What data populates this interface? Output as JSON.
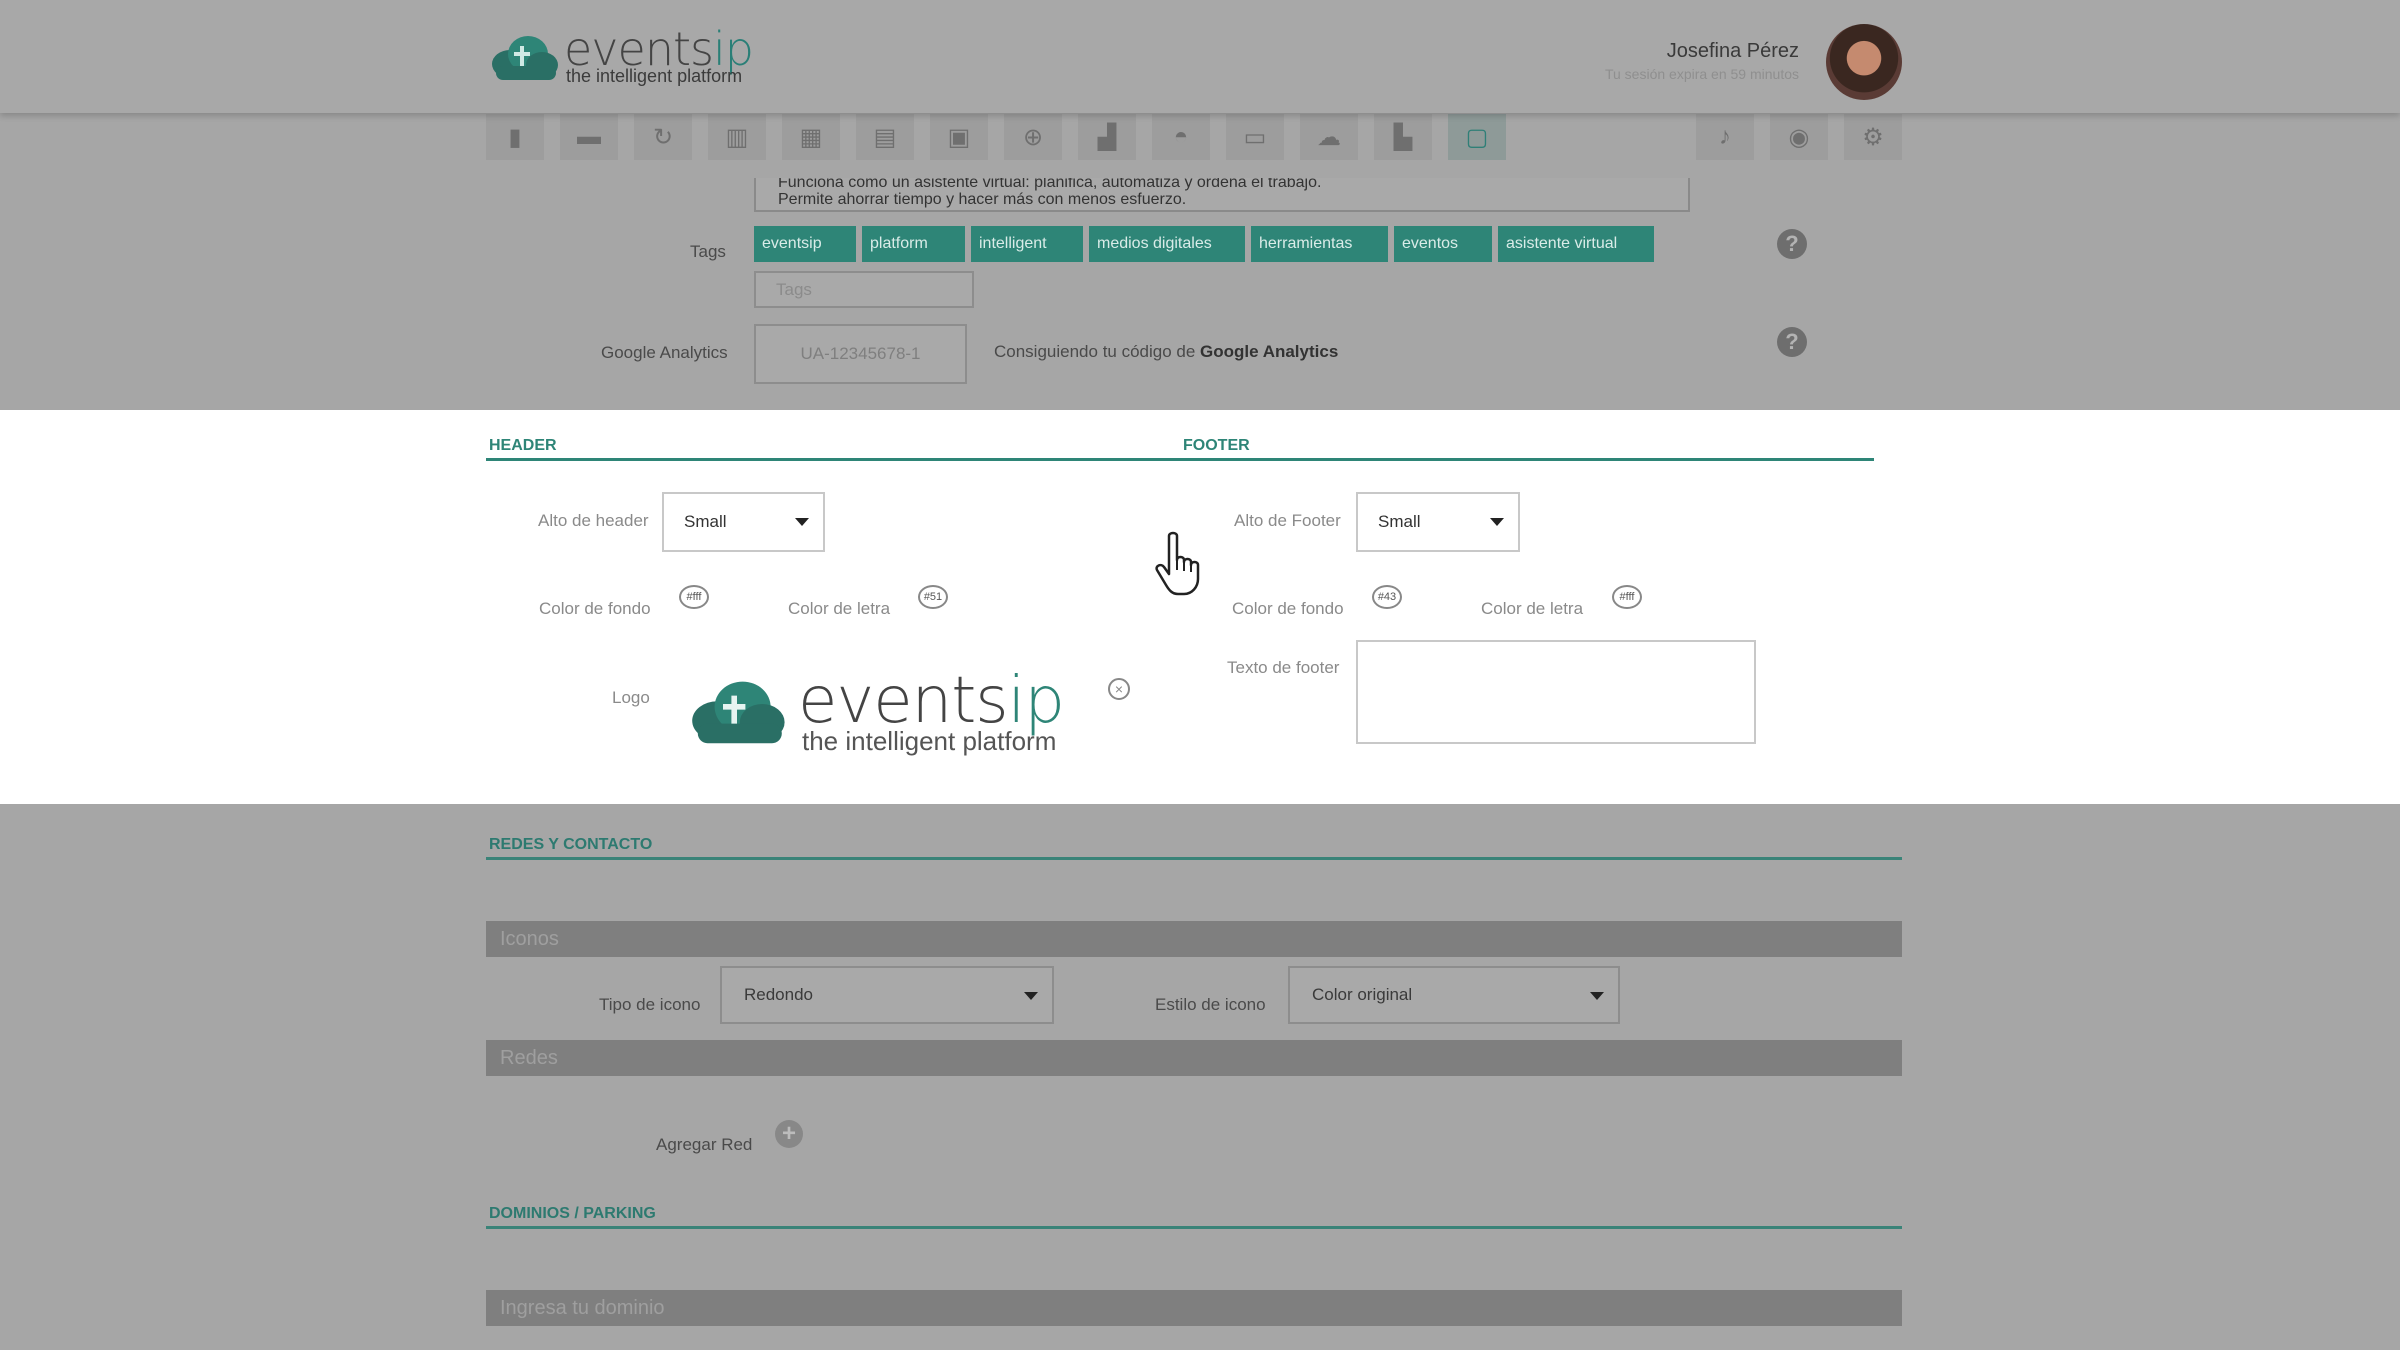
{
  "brand": {
    "name_main": "events",
    "name_accent": "ip",
    "tagline": "the intelligent platform",
    "color": "#2e8577"
  },
  "user": {
    "name": "Josefina Pérez",
    "session_note": "Tu sesión expira en 59 minutos"
  },
  "toolbar": {
    "icons": [
      "book-icon",
      "briefcase-icon",
      "refresh-icon",
      "trash-icon",
      "calendar-icon",
      "calculator-icon",
      "id-card-icon",
      "dollar-icon",
      "bar-chart-icon",
      "helmet-icon",
      "ticket-icon",
      "cloud-upload-icon",
      "factory-icon",
      "devices-icon"
    ],
    "right_icons": [
      "bell-icon",
      "circle-icon",
      "gear-icon"
    ]
  },
  "description": {
    "line1": "Funciona como un asistente virtual: planifica, automatiza y ordena el trabajo.",
    "line2": "Permite ahorrar tiempo y hacer más con menos esfuerzo."
  },
  "tags": {
    "label": "Tags",
    "items": [
      "eventsip",
      "platform",
      "intelligent",
      "medios digitales",
      "herramientas",
      "eventos",
      "asistente virtual"
    ],
    "placeholder": "Tags"
  },
  "analytics": {
    "label": "Google Analytics",
    "value": "UA-12345678-1",
    "hint_prefix": "Consiguiendo tu código de ",
    "hint_bold": "Google Analytics"
  },
  "header_section": {
    "title": "HEADER",
    "height_label": "Alto de header",
    "height_value": "Small",
    "bg_label": "Color de fondo",
    "bg_value": "#fff",
    "text_color_label": "Color de letra",
    "text_color_value": "#51",
    "logo_label": "Logo"
  },
  "footer_section": {
    "title": "FOOTER",
    "height_label": "Alto de Footer",
    "height_value": "Small",
    "bg_label": "Color de fondo",
    "bg_value": "#43",
    "text_color_label": "Color de letra",
    "text_color_value": "#fff",
    "text_label": "Texto de footer",
    "text_value": ""
  },
  "social": {
    "title": "REDES Y CONTACTO",
    "icons_bar": "Iconos",
    "icon_type_label": "Tipo de icono",
    "icon_type_value": "Redondo",
    "icon_style_label": "Estilo de icono",
    "icon_style_value": "Color original",
    "networks_bar": "Redes",
    "add_network_label": "Agregar Red"
  },
  "domains": {
    "title": "DOMINIOS / PARKING",
    "input_placeholder": "Ingresa tu dominio"
  },
  "help_symbol": "?",
  "add_symbol": "+",
  "remove_symbol": "×"
}
